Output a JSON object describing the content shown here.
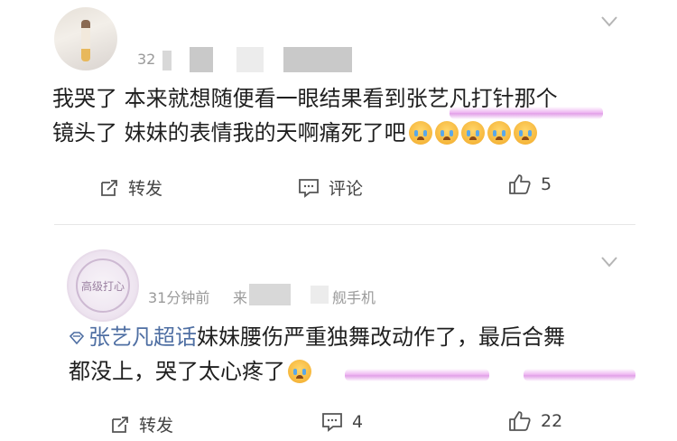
{
  "posts": [
    {
      "meta_text": "32",
      "content_line1": "我哭了 本来就想随便看一眼结果看到张艺凡打针那个",
      "content_line2": "镜头了 妹妹的表情我的天啊痛死了吧",
      "emoji_icon": "crying-emoji",
      "emoji_count": 5,
      "actions": {
        "repost_label": "转发",
        "comment_label": "评论",
        "like_count": "5"
      }
    },
    {
      "avatar_text": "高级打心",
      "meta_time": "31分钟前",
      "meta_source_prefix": "来",
      "meta_source_suffix": "舰手机",
      "topic_tag": "张艺凡超话",
      "content_line1_rest": "妹妹腰伤严重独舞改动作了，最后合舞",
      "content_line2": "都没上，哭了太心疼了",
      "actions": {
        "repost_label": "转发",
        "comment_count": "4",
        "like_count": "22"
      }
    }
  ],
  "colors": {
    "highlight": "#e07de8",
    "topic": "#4f6fa3",
    "meta": "#9a9a9a"
  }
}
